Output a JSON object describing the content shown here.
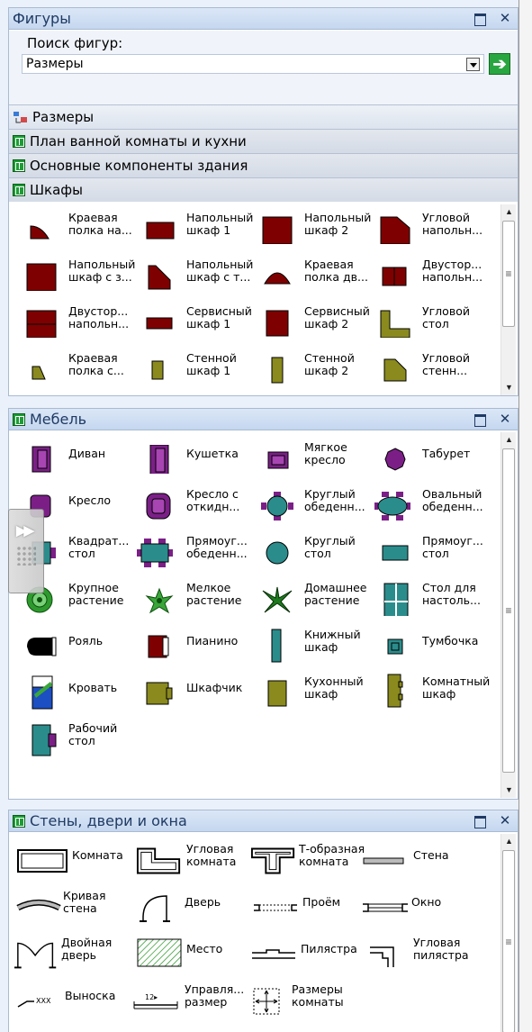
{
  "shapes_panel": {
    "title": "Фигуры",
    "search_label": "Поиск фигур:",
    "search_value": "Размеры",
    "stencils": [
      {
        "label": "Размеры",
        "icon": "dimension-stencil-icon"
      },
      {
        "label": "План ванной комнаты и кухни",
        "icon": "stencil-icon"
      },
      {
        "label": "Основные компоненты здания",
        "icon": "stencil-icon"
      },
      {
        "label": "Шкафы",
        "icon": "stencil-icon"
      }
    ],
    "shapes": [
      {
        "label": "Краевая полка на...",
        "icon": "edge-shelf-icon"
      },
      {
        "label": "Напольный шкаф 1",
        "icon": "floor-cabinet-icon"
      },
      {
        "label": "Напольный шкаф 2",
        "icon": "floor-cabinet-icon"
      },
      {
        "label": "Угловой напольн...",
        "icon": "corner-cabinet-icon"
      },
      {
        "label": "Напольный шкаф с з...",
        "icon": "floor-cabinet-icon"
      },
      {
        "label": "Напольный шкаф с т...",
        "icon": "corner-cabinet-icon"
      },
      {
        "label": "Краевая полка дв...",
        "icon": "edge-shelf-icon"
      },
      {
        "label": "Двустор... напольн...",
        "icon": "double-cabinet-icon"
      },
      {
        "label": "Двустор... напольн...",
        "icon": "double-cabinet-icon"
      },
      {
        "label": "Сервисный шкаф 1",
        "icon": "service-cabinet-icon"
      },
      {
        "label": "Сервисный шкаф 2",
        "icon": "service-cabinet-icon"
      },
      {
        "label": "Угловой стол",
        "icon": "corner-table-icon"
      },
      {
        "label": "Краевая полка с...",
        "icon": "edge-shelf-icon"
      },
      {
        "label": "Стенной шкаф 1",
        "icon": "wall-cabinet-icon"
      },
      {
        "label": "Стенной шкаф 2",
        "icon": "wall-cabinet-icon"
      },
      {
        "label": "Угловой стенн...",
        "icon": "corner-wall-cabinet-icon"
      }
    ]
  },
  "furniture_panel": {
    "title": "Мебель",
    "shapes": [
      {
        "label": "Диван",
        "icon": "sofa-icon"
      },
      {
        "label": "Кушетка",
        "icon": "couch-icon"
      },
      {
        "label": "Мягкое кресло",
        "icon": "soft-chair-icon"
      },
      {
        "label": "Табурет",
        "icon": "stool-icon"
      },
      {
        "label": "Кресло",
        "icon": "armchair-icon"
      },
      {
        "label": "Кресло с откидн...",
        "icon": "recliner-icon"
      },
      {
        "label": "Круглый обеденн...",
        "icon": "round-dining-table-icon"
      },
      {
        "label": "Овальный обеденн...",
        "icon": "oval-dining-table-icon"
      },
      {
        "label": "Квадрат... стол",
        "icon": "square-table-icon"
      },
      {
        "label": "Прямоуг... обеденн...",
        "icon": "rect-dining-table-icon"
      },
      {
        "label": "Круглый стол",
        "icon": "round-table-icon"
      },
      {
        "label": "Прямоуг... стол",
        "icon": "rect-table-icon"
      },
      {
        "label": "Крупное растение",
        "icon": "large-plant-icon"
      },
      {
        "label": "Мелкое растение",
        "icon": "small-plant-icon"
      },
      {
        "label": "Домашнее растение",
        "icon": "house-plant-icon"
      },
      {
        "label": "Стол для настоль...",
        "icon": "board-game-table-icon"
      },
      {
        "label": "Рояль",
        "icon": "grand-piano-icon"
      },
      {
        "label": "Пианино",
        "icon": "piano-icon"
      },
      {
        "label": "Книжный шкаф",
        "icon": "bookcase-icon"
      },
      {
        "label": "Тумбочка",
        "icon": "nightstand-icon"
      },
      {
        "label": "Кровать",
        "icon": "bed-icon"
      },
      {
        "label": "Шкафчик",
        "icon": "cabinet-icon"
      },
      {
        "label": "Кухонный шкаф",
        "icon": "kitchen-cabinet-icon"
      },
      {
        "label": "Комнатный шкаф",
        "icon": "room-cabinet-icon"
      },
      {
        "label": "Рабочий стол",
        "icon": "desk-icon"
      }
    ]
  },
  "walls_panel": {
    "title": "Стены, двери и окна",
    "shapes": [
      {
        "label": "Комната",
        "icon": "room-icon"
      },
      {
        "label": "Угловая комната",
        "icon": "corner-room-icon"
      },
      {
        "label": "Т-образная комната",
        "icon": "t-room-icon"
      },
      {
        "label": "Стена",
        "icon": "wall-icon"
      },
      {
        "label": "Кривая стена",
        "icon": "curved-wall-icon"
      },
      {
        "label": "Дверь",
        "icon": "door-icon"
      },
      {
        "label": "Проём",
        "icon": "opening-icon"
      },
      {
        "label": "Окно",
        "icon": "window-icon"
      },
      {
        "label": "Двойная дверь",
        "icon": "double-door-icon"
      },
      {
        "label": "Место",
        "icon": "space-icon"
      },
      {
        "label": "Пилястра",
        "icon": "pilaster-icon"
      },
      {
        "label": "Угловая пилястра",
        "icon": "corner-pilaster-icon"
      },
      {
        "label": "Выноска",
        "icon": "callout-icon"
      },
      {
        "label": "Управля... размер",
        "icon": "controller-dimension-icon"
      },
      {
        "label": "Размеры комнаты",
        "icon": "room-dimensions-icon"
      }
    ]
  },
  "colors": {
    "maroon": "#7f0000",
    "purple": "#7b1f87",
    "teal": "#2b8c8c",
    "olive": "#8a8a1e",
    "green_accent": "#2aa640"
  }
}
